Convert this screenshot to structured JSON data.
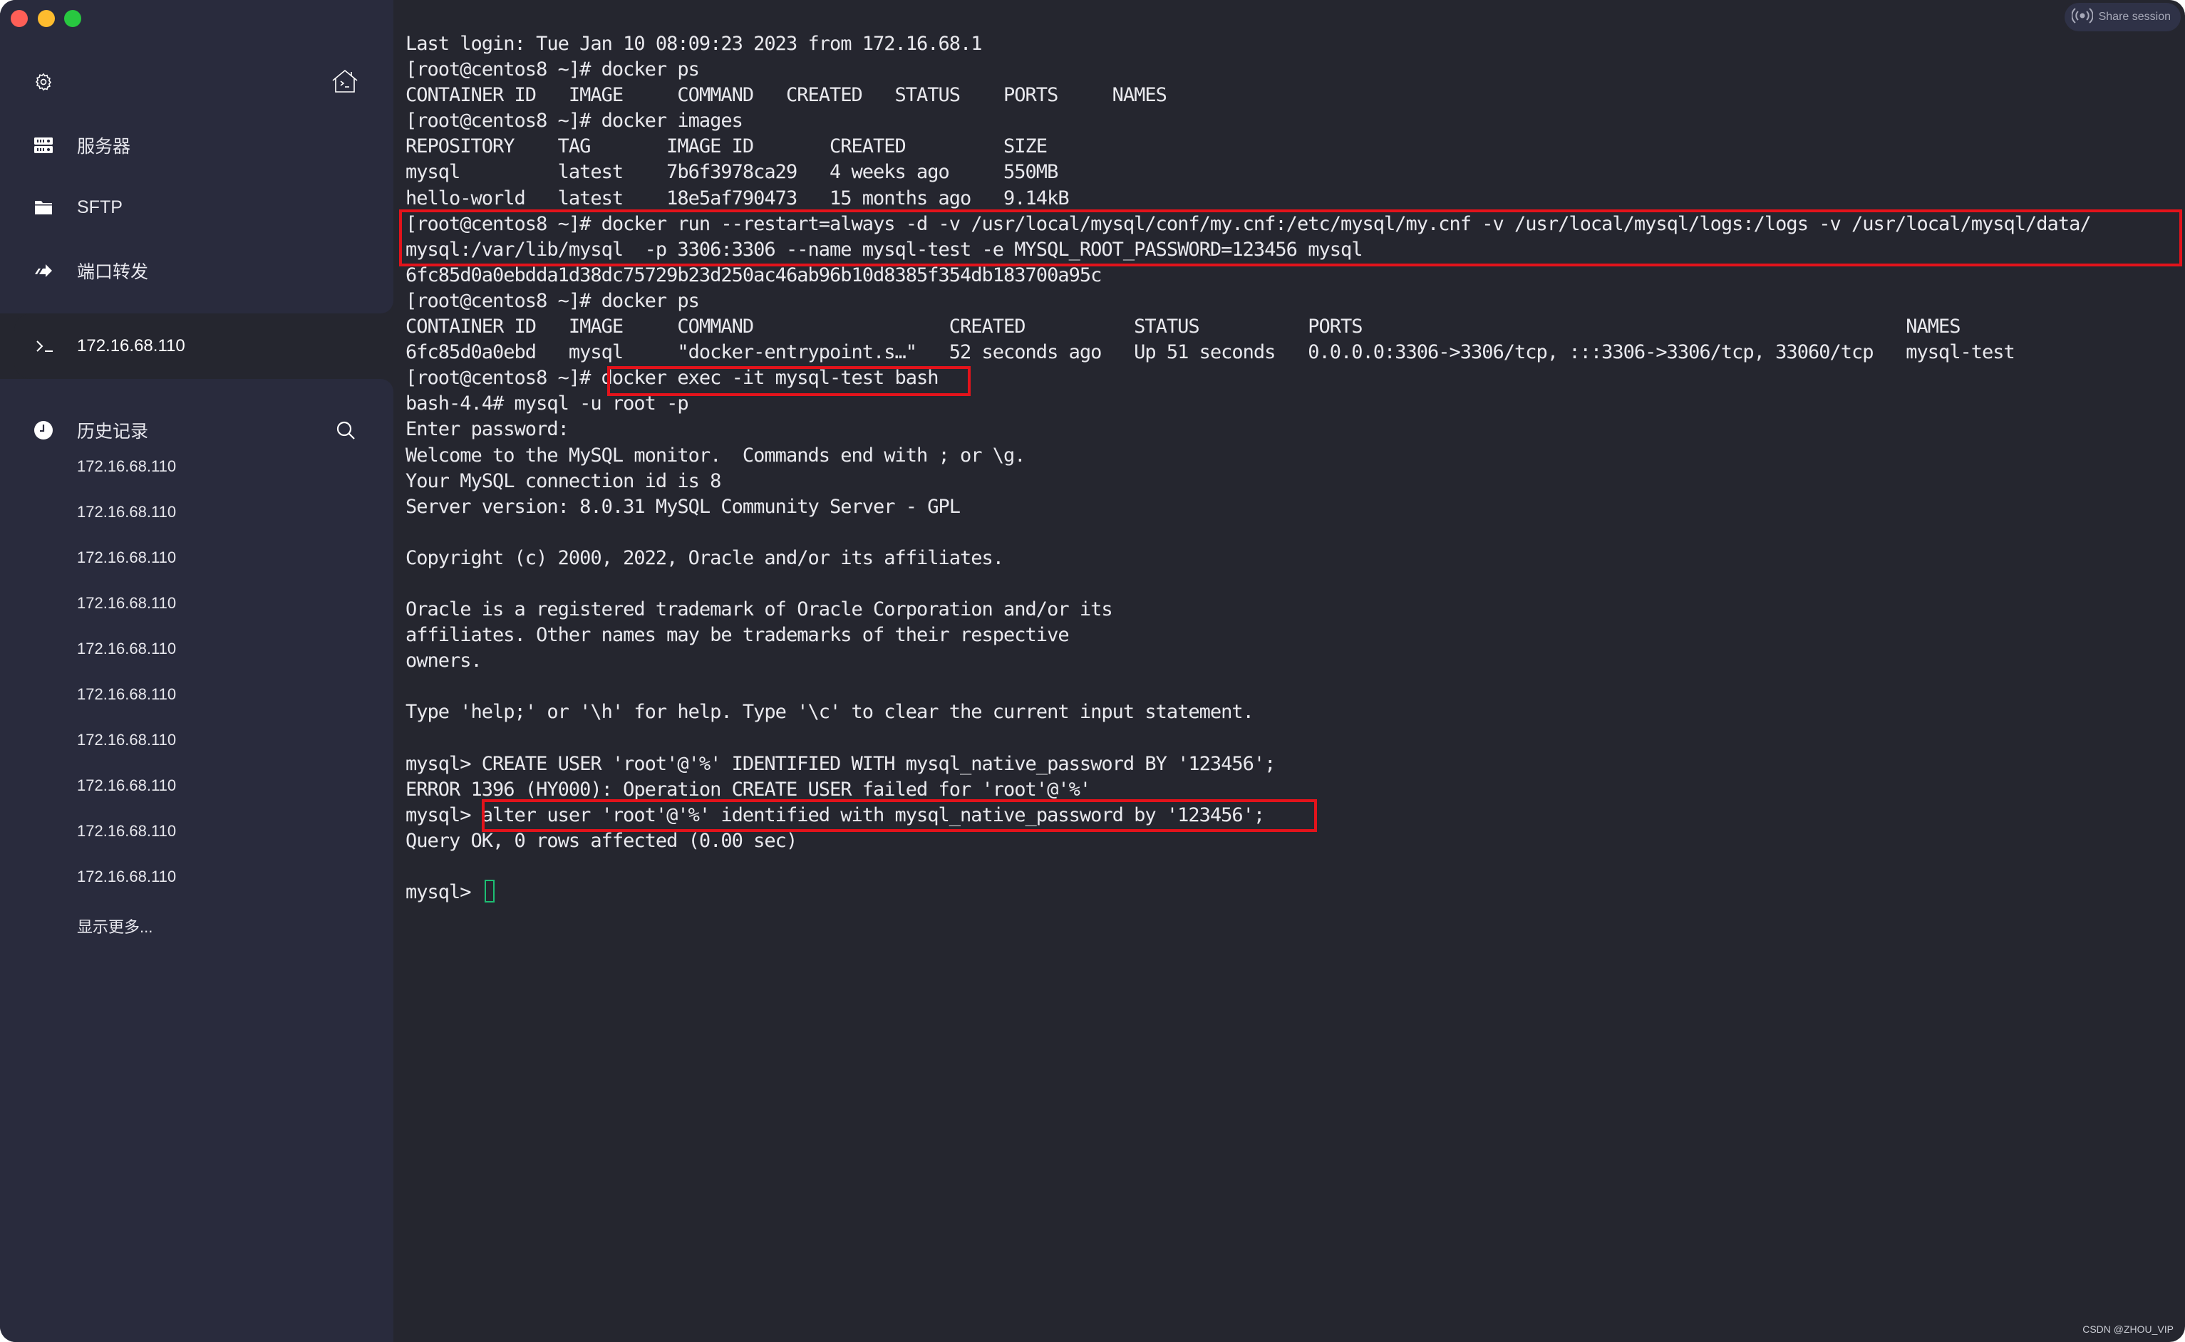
{
  "window": {
    "controls": [
      "close",
      "minimize",
      "maximize"
    ],
    "share_button": {
      "label": "Share session",
      "icon": "broadcast-icon"
    },
    "watermark": "CSDN @ZHOU_VIP"
  },
  "sidebar": {
    "top_icons": {
      "settings": "gear-icon",
      "home": "terminal-home-icon"
    },
    "nav_items": [
      {
        "label": "服务器",
        "icon": "server-icon"
      },
      {
        "label": "SFTP",
        "icon": "folder-icon"
      },
      {
        "label": "端口转发",
        "icon": "port-forward-icon"
      }
    ],
    "active_session": {
      "label": "172.16.68.110",
      "icon": "terminal-prompt-icon"
    },
    "history": {
      "title": "历史记录",
      "icon": "clock-icon",
      "search_icon": "search-icon",
      "items": [
        "172.16.68.110",
        "172.16.68.110",
        "172.16.68.110",
        "172.16.68.110",
        "172.16.68.110",
        "172.16.68.110",
        "172.16.68.110",
        "172.16.68.110",
        "172.16.68.110",
        "172.16.68.110"
      ],
      "show_more": "显示更多..."
    }
  },
  "terminal": {
    "lines": [
      "Last login: Tue Jan 10 08:09:23 2023 from 172.16.68.1",
      "[root@centos8 ~]# docker ps",
      "CONTAINER ID   IMAGE     COMMAND   CREATED   STATUS    PORTS     NAMES",
      "[root@centos8 ~]# docker images",
      "REPOSITORY    TAG       IMAGE ID       CREATED         SIZE",
      "mysql         latest    7b6f3978ca29   4 weeks ago     550MB",
      "hello-world   latest    18e5af790473   15 months ago   9.14kB",
      "[root@centos8 ~]# docker run --restart=always -d -v /usr/local/mysql/conf/my.cnf:/etc/mysql/my.cnf -v /usr/local/mysql/logs:/logs -v /usr/local/mysql/data/",
      "mysql:/var/lib/mysql  -p 3306:3306 --name mysql-test -e MYSQL_ROOT_PASSWORD=123456 mysql",
      "6fc85d0a0ebdda1d38dc75729b23d250ac46ab96b10d8385f354db183700a95c",
      "[root@centos8 ~]# docker ps",
      "CONTAINER ID   IMAGE     COMMAND                  CREATED          STATUS          PORTS                                                  NAMES",
      "6fc85d0a0ebd   mysql     \"docker-entrypoint.s…\"   52 seconds ago   Up 51 seconds   0.0.0.0:3306->3306/tcp, :::3306->3306/tcp, 33060/tcp   mysql-test",
      "[root@centos8 ~]# docker exec -it mysql-test bash",
      "bash-4.4# mysql -u root -p",
      "Enter password:",
      "Welcome to the MySQL monitor.  Commands end with ; or \\g.",
      "Your MySQL connection id is 8",
      "Server version: 8.0.31 MySQL Community Server - GPL",
      "",
      "Copyright (c) 2000, 2022, Oracle and/or its affiliates.",
      "",
      "Oracle is a registered trademark of Oracle Corporation and/or its",
      "affiliates. Other names may be trademarks of their respective",
      "owners.",
      "",
      "Type 'help;' or '\\h' for help. Type '\\c' to clear the current input statement.",
      "",
      "mysql> CREATE USER 'root'@'%' IDENTIFIED WITH mysql_native_password BY '123456';",
      "ERROR 1396 (HY000): Operation CREATE USER failed for 'root'@'%'",
      "mysql> alter user 'root'@'%' identified with mysql_native_password by '123456';",
      "Query OK, 0 rows affected (0.00 sec)",
      ""
    ],
    "prompt": "mysql> ",
    "highlight_color": "#e3131b",
    "cursor_color": "#1dbf73"
  }
}
